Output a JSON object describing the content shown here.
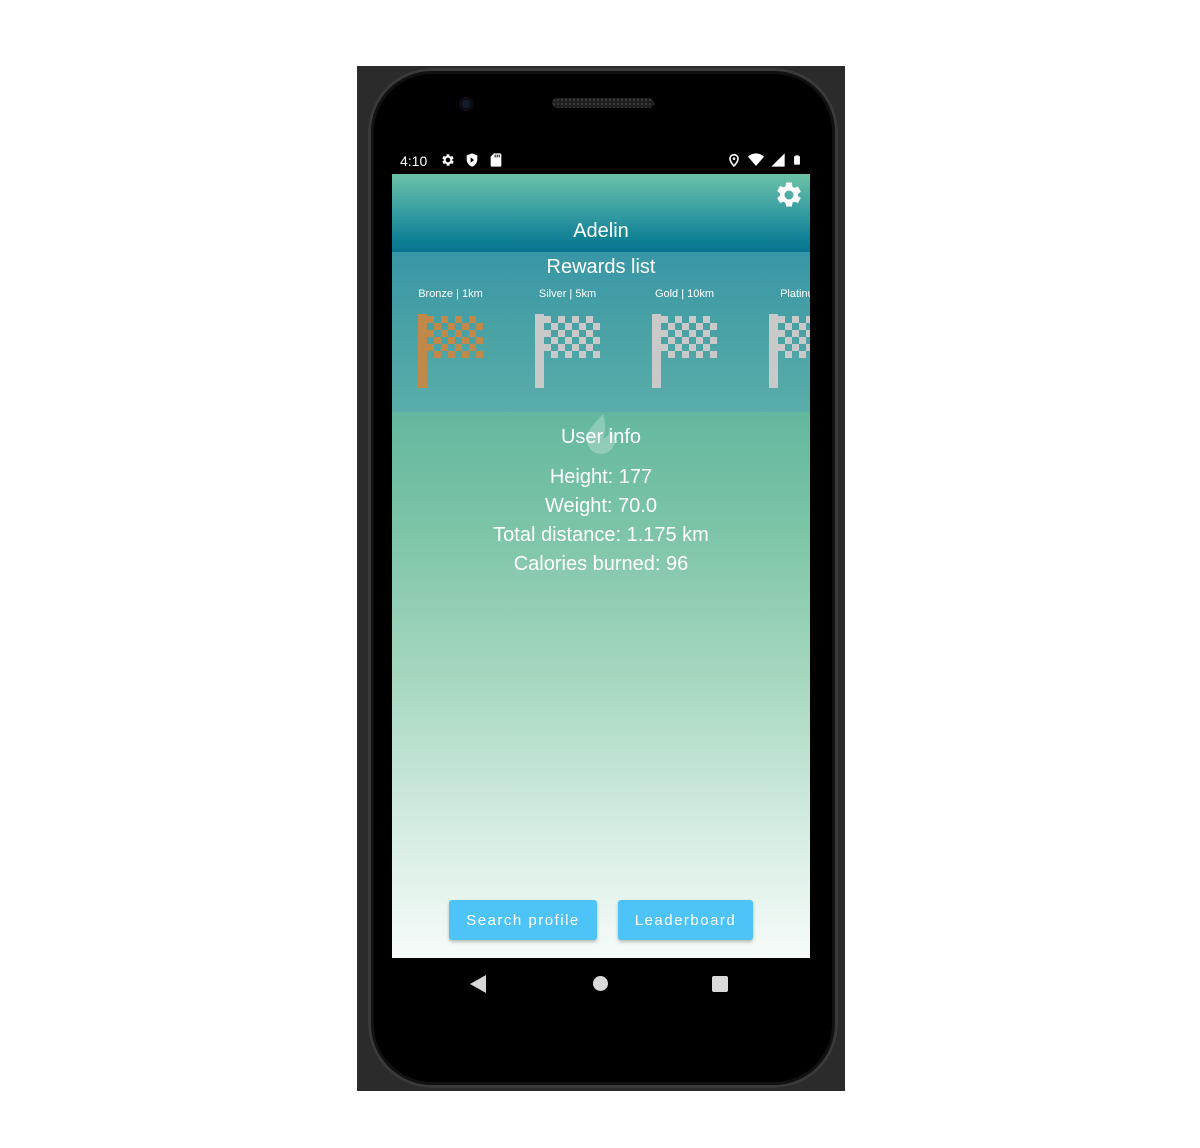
{
  "status_bar": {
    "time": "4:10",
    "left_icons": [
      "gear-icon",
      "shield-icon",
      "sd-card-icon"
    ],
    "right_icons": [
      "location-icon",
      "wifi-icon",
      "signal-icon",
      "battery-icon"
    ]
  },
  "header": {
    "username": "Adelin",
    "settings_icon": "gear-icon"
  },
  "rewards": {
    "title": "Rewards list",
    "items": [
      {
        "label": "Bronze | 1km",
        "flag_color": "#c0894a"
      },
      {
        "label": "Silver | 5km",
        "flag_color": "#c9c9c9"
      },
      {
        "label": "Gold | 10km",
        "flag_color": "#c9c9c9"
      },
      {
        "label": "Platinum",
        "flag_color": "#c9c9c9"
      }
    ]
  },
  "user_info": {
    "title": "User info",
    "height": "Height: 177",
    "weight": "Weight: 70.0",
    "total_distance": "Total distance: 1.175 km",
    "calories": "Calories burned: 96"
  },
  "buttons": {
    "search_profile": "Search profile",
    "leaderboard": "Leaderboard"
  },
  "colors": {
    "accent_button": "#4dc3f7",
    "header_dark": "#0a7391"
  }
}
